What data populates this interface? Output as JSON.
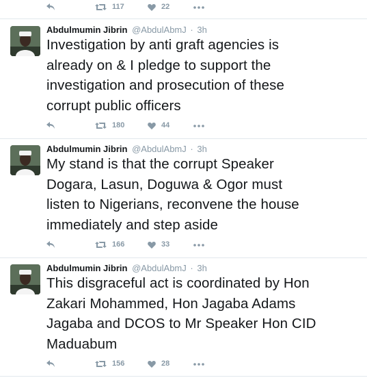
{
  "top_actions": {
    "retweets": "117",
    "likes": "22"
  },
  "tweets": [
    {
      "author": "Abdulmumin Jibrin",
      "handle": "@AbdulAbmJ",
      "time": "3h",
      "text": "Investigation by anti graft agencies is\nalready on & I pledge to support the\ninvestigation and prosecution of these\ncorrupt public officers",
      "retweets": "180",
      "likes": "44"
    },
    {
      "author": "Abdulmumin Jibrin",
      "handle": "@AbdulAbmJ",
      "time": "3h",
      "text": "My stand is that the corrupt Speaker\nDogara, Lasun, Doguwa & Ogor must\nlisten to Nigerians, reconvene the house\nimmediately and step aside",
      "retweets": "166",
      "likes": "33"
    },
    {
      "author": "Abdulmumin Jibrin",
      "handle": "@AbdulAbmJ",
      "time": "3h",
      "text": "This disgraceful act is coordinated by Hon\nZakari Mohammed, Hon Jagaba Adams\nJagaba and DCOS to Mr Speaker Hon CID\nMaduabum",
      "retweets": "156",
      "likes": "28"
    }
  ],
  "separator": "·",
  "icons": [
    "reply-icon",
    "retweet-icon",
    "heart-icon",
    "more-icon"
  ],
  "colors": {
    "icon_gray": "#8899a6",
    "divider": "#e1e8ed",
    "text": "#14171a"
  }
}
